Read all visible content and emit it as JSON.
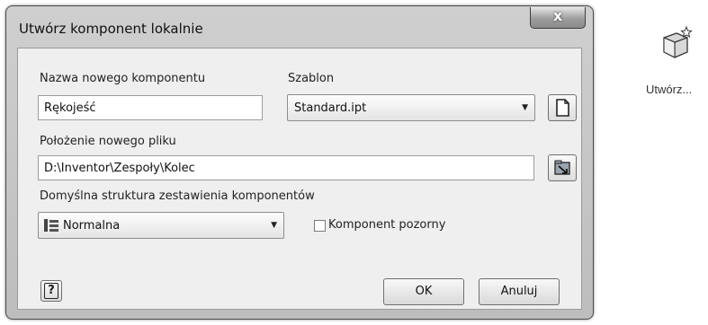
{
  "dialog": {
    "title": "Utwórz komponent lokalnie",
    "close_glyph": "x",
    "name_label": "Nazwa nowego komponentu",
    "name_value": "Rękojeść",
    "template_label": "Szablon",
    "template_value": "Standard.ipt",
    "location_label": "Położenie nowego pliku",
    "location_value": "D:\\Inventor\\Zespoły\\Kolec",
    "bom_label": "Domyślna struktura zestawienia komponentów",
    "bom_value": "Normalna",
    "virtual_label": "Komponent pozorny",
    "virtual_checked": false,
    "help_glyph": "?",
    "ok_label": "OK",
    "cancel_label": "Anuluj"
  },
  "icons": {
    "new_template": "document-icon",
    "browse": "folder-arrow-icon",
    "bom": "bom-structure-icon",
    "help": "help-icon",
    "tool": "create-component-icon"
  },
  "side_tool": {
    "label": "Utwórz..."
  },
  "colors": {
    "frame": "#c6c6c6",
    "client": "#efefef",
    "field": "#ffffff"
  }
}
